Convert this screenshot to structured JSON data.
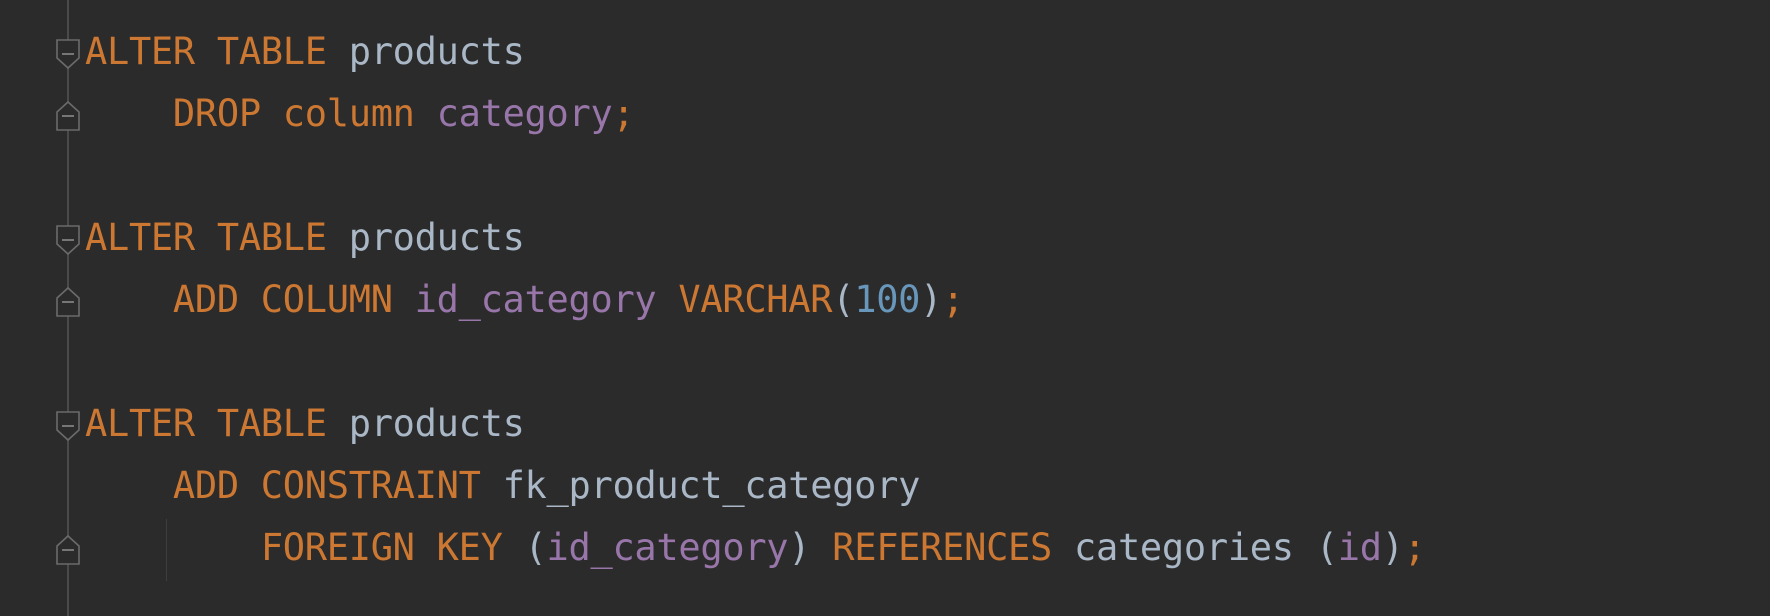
{
  "editor": {
    "language": "SQL",
    "colors": {
      "background": "#2b2b2b",
      "keyword": "#cc7832",
      "identifier": "#a9b7c6",
      "column": "#9876aa",
      "number": "#6897bb"
    },
    "lines": [
      {
        "tokens": [
          {
            "t": "ALTER TABLE",
            "c": "kw"
          },
          {
            "t": " ",
            "c": "id"
          },
          {
            "t": "products",
            "c": "id"
          }
        ]
      },
      {
        "tokens": [
          {
            "t": "    ",
            "c": "id"
          },
          {
            "t": "DROP column",
            "c": "kw"
          },
          {
            "t": " ",
            "c": "id"
          },
          {
            "t": "category",
            "c": "col"
          },
          {
            "t": ";",
            "c": "pun"
          }
        ]
      },
      {
        "tokens": []
      },
      {
        "tokens": [
          {
            "t": "ALTER TABLE",
            "c": "kw"
          },
          {
            "t": " ",
            "c": "id"
          },
          {
            "t": "products",
            "c": "id"
          }
        ]
      },
      {
        "tokens": [
          {
            "t": "    ",
            "c": "id"
          },
          {
            "t": "ADD COLUMN",
            "c": "kw"
          },
          {
            "t": " ",
            "c": "id"
          },
          {
            "t": "id_category",
            "c": "col"
          },
          {
            "t": " ",
            "c": "id"
          },
          {
            "t": "VARCHAR",
            "c": "kw"
          },
          {
            "t": "(",
            "c": "par"
          },
          {
            "t": "100",
            "c": "num"
          },
          {
            "t": ")",
            "c": "par"
          },
          {
            "t": ";",
            "c": "pun"
          }
        ]
      },
      {
        "tokens": []
      },
      {
        "tokens": [
          {
            "t": "ALTER TABLE",
            "c": "kw"
          },
          {
            "t": " ",
            "c": "id"
          },
          {
            "t": "products",
            "c": "id"
          }
        ]
      },
      {
        "tokens": [
          {
            "t": "    ",
            "c": "id"
          },
          {
            "t": "ADD CONSTRAINT",
            "c": "kw"
          },
          {
            "t": " ",
            "c": "id"
          },
          {
            "t": "fk_product_category",
            "c": "id"
          }
        ]
      },
      {
        "tokens": [
          {
            "t": "        ",
            "c": "id"
          },
          {
            "t": "FOREIGN KEY",
            "c": "kw"
          },
          {
            "t": " ",
            "c": "id"
          },
          {
            "t": "(",
            "c": "par"
          },
          {
            "t": "id_category",
            "c": "col"
          },
          {
            "t": ")",
            "c": "par"
          },
          {
            "t": " ",
            "c": "id"
          },
          {
            "t": "REFERENCES",
            "c": "kw"
          },
          {
            "t": " ",
            "c": "id"
          },
          {
            "t": "categories",
            "c": "id"
          },
          {
            "t": " ",
            "c": "id"
          },
          {
            "t": "(",
            "c": "par"
          },
          {
            "t": "id",
            "c": "col"
          },
          {
            "t": ")",
            "c": "par"
          },
          {
            "t": ";",
            "c": "pun"
          }
        ]
      }
    ],
    "folds": [
      {
        "line": 0,
        "kind": "start"
      },
      {
        "line": 1,
        "kind": "end"
      },
      {
        "line": 3,
        "kind": "start"
      },
      {
        "line": 4,
        "kind": "end"
      },
      {
        "line": 6,
        "kind": "start"
      },
      {
        "line": 8,
        "kind": "end"
      }
    ]
  }
}
